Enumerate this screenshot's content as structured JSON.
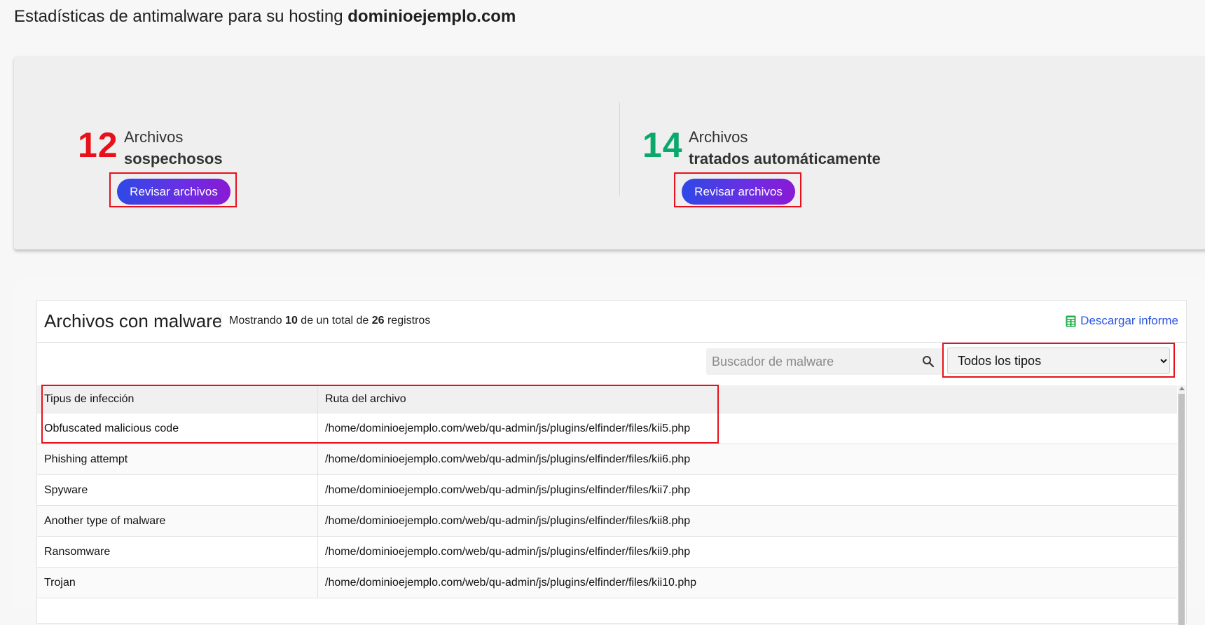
{
  "page": {
    "title_prefix": "Estadísticas de antimalware para su hosting",
    "title_domain": "dominioejemplo.com"
  },
  "stats": [
    {
      "number": "12",
      "label_top": "Archivos",
      "label_bottom": "sospechosos",
      "button_label": "Revisar archivos",
      "color": "#e8101a"
    },
    {
      "number": "14",
      "label_top": "Archivos",
      "label_bottom": "tratados automáticamente",
      "button_label": "Revisar archivos",
      "color": "#0aa86a"
    }
  ],
  "malware": {
    "title": "Archivos con malware",
    "count_prefix": "Mostrando",
    "count_shown": "10",
    "count_middle": "de un total de",
    "count_total": "26",
    "count_suffix": "registros",
    "download_label": "Descargar informe",
    "search_placeholder": "Buscador de malware",
    "type_select_value": "Todos los tipos",
    "columns": [
      "Tipus de infección",
      "Ruta del archivo"
    ],
    "rows": [
      [
        "Obfuscated malicious code",
        "/home/dominioejemplo.com/web/qu-admin/js/plugins/elfinder/files/kii5.php"
      ],
      [
        "Phishing attempt",
        "/home/dominioejemplo.com/web/qu-admin/js/plugins/elfinder/files/kii6.php"
      ],
      [
        "Spyware",
        "/home/dominioejemplo.com/web/qu-admin/js/plugins/elfinder/files/kii7.php"
      ],
      [
        "Another type of malware",
        "/home/dominioejemplo.com/web/qu-admin/js/plugins/elfinder/files/kii8.php"
      ],
      [
        "Ransomware",
        "/home/dominioejemplo.com/web/qu-admin/js/plugins/elfinder/files/kii9.php"
      ],
      [
        "Trojan",
        "/home/dominioejemplo.com/web/qu-admin/js/plugins/elfinder/files/kii10.php"
      ]
    ]
  },
  "colors": {
    "accent_red": "#e8101a",
    "accent_green": "#0aa86a",
    "link_blue": "#2b54e1",
    "button_gradient_start": "#2e49e6",
    "button_gradient_end": "#8a19d4"
  },
  "icons": {
    "download": "spreadsheet-icon",
    "search": "search-icon",
    "select": "chevron-down-icon"
  }
}
